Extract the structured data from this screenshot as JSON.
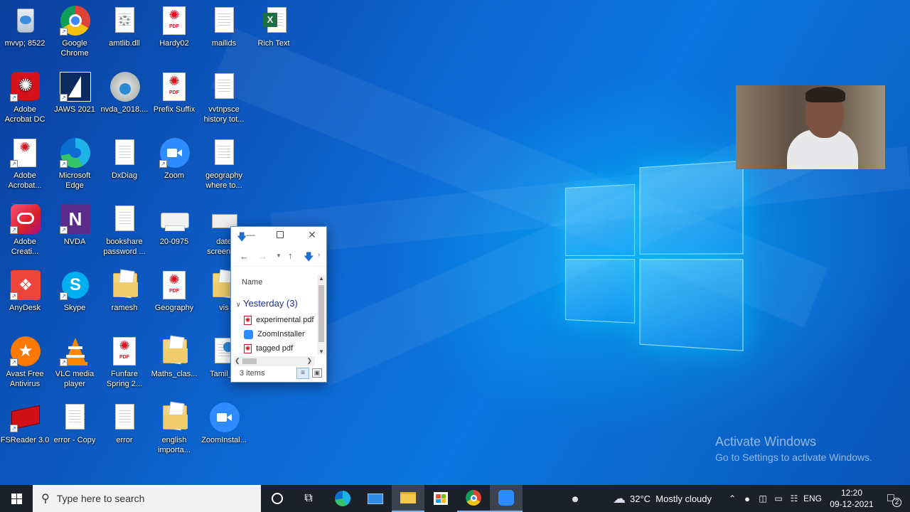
{
  "desktop": {
    "icons": [
      {
        "label": "mvvp; 8522",
        "kind": "recycle-bin"
      },
      {
        "label": "Google Chrome",
        "kind": "chrome"
      },
      {
        "label": "amtlib.dll",
        "kind": "dll"
      },
      {
        "label": "Hardy02",
        "kind": "pdf"
      },
      {
        "label": "mailids",
        "kind": "text"
      },
      {
        "label": "Rich Text",
        "kind": "excel"
      },
      {
        "label": "Adobe Acrobat DC",
        "kind": "acrobat"
      },
      {
        "label": "JAWS 2021",
        "kind": "jaws"
      },
      {
        "label": "nvda_2018....",
        "kind": "installer"
      },
      {
        "label": "Prefix Suffix",
        "kind": "pdf"
      },
      {
        "label": "vvtnpsce history tot...",
        "kind": "text"
      },
      {
        "label": "Adobe Acrobat...",
        "kind": "acrobat"
      },
      {
        "label": "Microsoft Edge",
        "kind": "edge"
      },
      {
        "label": "DxDiag",
        "kind": "text"
      },
      {
        "label": "Zoom",
        "kind": "zoom"
      },
      {
        "label": "geography where to...",
        "kind": "text"
      },
      {
        "label": "Adobe Creati...",
        "kind": "creative-cloud"
      },
      {
        "label": "NVDA",
        "kind": "nvda"
      },
      {
        "label": "bookshare password ...",
        "kind": "text"
      },
      {
        "label": "20-0975",
        "kind": "printer"
      },
      {
        "label": "date screens...",
        "kind": "scanner"
      },
      {
        "label": "AnyDesk",
        "kind": "anydesk"
      },
      {
        "label": "Skype",
        "kind": "skype"
      },
      {
        "label": "ramesh",
        "kind": "folder"
      },
      {
        "label": "Geography",
        "kind": "pdf"
      },
      {
        "label": "vis",
        "kind": "folder"
      },
      {
        "label": "Avast Free Antivirus",
        "kind": "avast"
      },
      {
        "label": "VLC media player",
        "kind": "vlc"
      },
      {
        "label": "Funfare Spring 2...",
        "kind": "pdf"
      },
      {
        "label": "Maths_clas...",
        "kind": "folder"
      },
      {
        "label": "Tamil_cl",
        "kind": "html"
      },
      {
        "label": "FSReader 3.0",
        "kind": "fsreader"
      },
      {
        "label": "error - Copy",
        "kind": "text"
      },
      {
        "label": "error",
        "kind": "text"
      },
      {
        "label": "english importa...",
        "kind": "folder"
      },
      {
        "label": "ZoomInstal...",
        "kind": "zoom"
      }
    ],
    "watermark": {
      "heading": "Activate Windows",
      "sub": "Go to Settings to activate Windows."
    }
  },
  "explorer": {
    "column_header": "Name",
    "group_label": "Yesterday (3)",
    "files": [
      {
        "name": "experimental pdf",
        "icon": "pdf-file-icon"
      },
      {
        "name": "ZoomInstaller",
        "icon": "zoom-file-icon"
      },
      {
        "name": "tagged pdf",
        "icon": "pdf-file-icon"
      }
    ],
    "status": "3 items"
  },
  "taskbar": {
    "search_placeholder": "Type here to search",
    "weather": "32°C  Mostly cloudy",
    "language": "ENG",
    "time": "12:20",
    "date": "09-12-2021",
    "notification_count": "2"
  },
  "colors": {
    "taskbar": "#1c2129",
    "accent": "#0078d7",
    "wallpaper": "#0d6ad6"
  }
}
